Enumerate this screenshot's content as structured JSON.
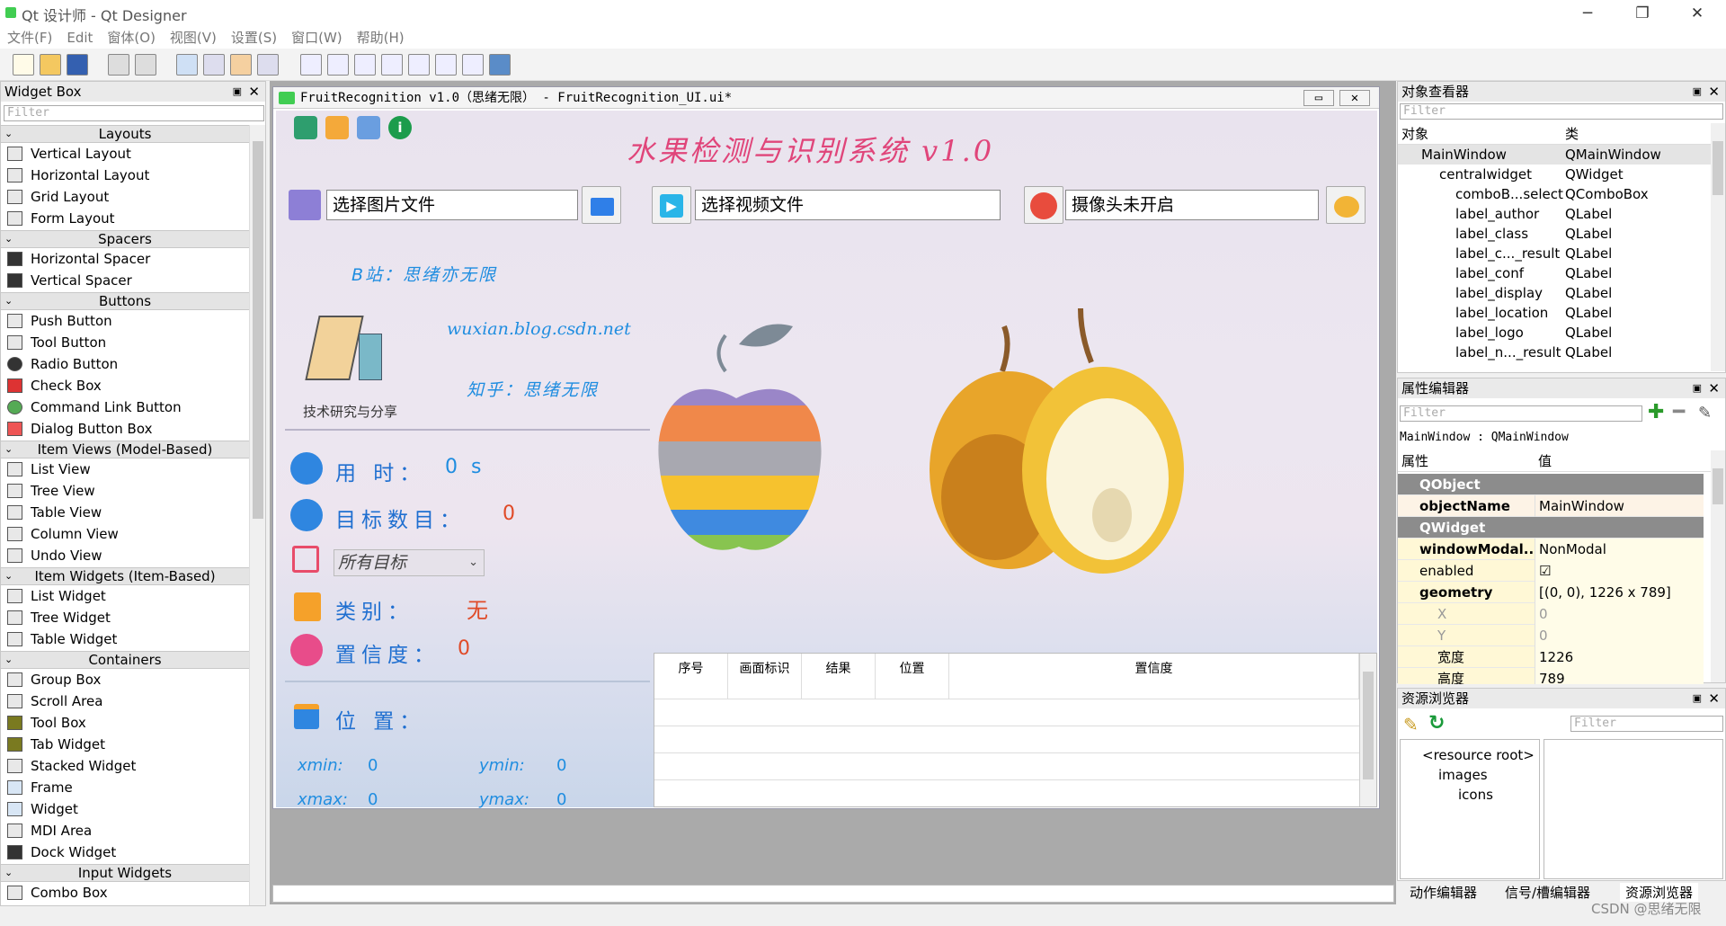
{
  "window": {
    "title": "Qt 设计师 - Qt Designer",
    "min": "─",
    "max": "❐",
    "close": "✕"
  },
  "menu": [
    "文件(F)",
    "Edit",
    "窗体(O)",
    "视图(V)",
    "设置(S)",
    "窗口(W)",
    "帮助(H)"
  ],
  "widget_box": {
    "title": "Widget Box",
    "filter": "Filter",
    "sections": {
      "layouts": "Layouts",
      "spacers": "Spacers",
      "buttons": "Buttons",
      "item_views": "Item Views (Model-Based)",
      "item_widgets": "Item Widgets (Item-Based)",
      "containers": "Containers",
      "input_widgets": "Input Widgets"
    },
    "layouts": [
      "Vertical Layout",
      "Horizontal Layout",
      "Grid Layout",
      "Form Layout"
    ],
    "spacers": [
      "Horizontal Spacer",
      "Vertical Spacer"
    ],
    "buttons": [
      "Push Button",
      "Tool Button",
      "Radio Button",
      "Check Box",
      "Command Link Button",
      "Dialog Button Box"
    ],
    "item_views": [
      "List View",
      "Tree View",
      "Table View",
      "Column View",
      "Undo View"
    ],
    "item_widgets": [
      "List Widget",
      "Tree Widget",
      "Table Widget"
    ],
    "containers": [
      "Group Box",
      "Scroll Area",
      "Tool Box",
      "Tab Widget",
      "Stacked Widget",
      "Frame",
      "Widget",
      "MDI Area",
      "Dock Widget"
    ],
    "input_widgets": [
      "Combo Box"
    ]
  },
  "form": {
    "title": "FruitRecognition v1.0（思绪无限） - FruitRecognition_UI.ui*",
    "app_title": "水果检测与识别系统  v1.0",
    "image_input": "选择图片文件",
    "video_input": "选择视频文件",
    "camera_input": "摄像头未开启",
    "bilibili": "B站：思绪亦无限",
    "blog": "wuxian.blog.csdn.net",
    "zhihu": "知乎：思绪无限",
    "logo_caption": "技术研究与分享",
    "time_label": "用 时：",
    "time_value": "0 s",
    "count_label": "目标数目：",
    "count_value": "0",
    "target_select": "所有目标",
    "class_label": "类别：",
    "class_value": "无",
    "conf_label": "置信度：",
    "conf_value": "0",
    "loc_label": "位 置：",
    "xmin_label": "xmin:",
    "xmin_value": "0",
    "ymin_label": "ymin:",
    "ymin_value": "0",
    "xmax_label": "xmax:",
    "xmax_value": "0",
    "ymax_label": "ymax:",
    "ymax_value": "0",
    "table_headers": [
      "序号",
      "画面标识",
      "结果",
      "位置",
      "置信度"
    ]
  },
  "object_inspector": {
    "title": "对象查看器",
    "filter": "Filter",
    "col_object": "对象",
    "col_class": "类",
    "rows": [
      [
        "MainWindow",
        "QMainWindow"
      ],
      [
        "centralwidget",
        "QWidget"
      ],
      [
        "comboB...select",
        "QComboBox"
      ],
      [
        "label_author",
        "QLabel"
      ],
      [
        "label_class",
        "QLabel"
      ],
      [
        "label_c..._result",
        "QLabel"
      ],
      [
        "label_conf",
        "QLabel"
      ],
      [
        "label_display",
        "QLabel"
      ],
      [
        "label_location",
        "QLabel"
      ],
      [
        "label_logo",
        "QLabel"
      ],
      [
        "label_n..._result",
        "QLabel"
      ]
    ]
  },
  "property_editor": {
    "title": "属性编辑器",
    "filter": "Filter",
    "context": "MainWindow : QMainWindow",
    "col_prop": "属性",
    "col_val": "值",
    "rows": [
      {
        "k": "QObject",
        "v": "",
        "type": "group"
      },
      {
        "k": "objectName",
        "v": "MainWindow",
        "type": "bold"
      },
      {
        "k": "QWidget",
        "v": "",
        "type": "group"
      },
      {
        "k": "windowModal...",
        "v": "NonModal",
        "type": "yellow"
      },
      {
        "k": "enabled",
        "v": "☑",
        "type": "yellow"
      },
      {
        "k": "geometry",
        "v": "[(0, 0), 1226 x 789]",
        "type": "yellowbold"
      },
      {
        "k": "X",
        "v": "0",
        "type": "sub"
      },
      {
        "k": "Y",
        "v": "0",
        "type": "sub"
      },
      {
        "k": "宽度",
        "v": "1226",
        "type": "sub"
      },
      {
        "k": "高度",
        "v": "789",
        "type": "sub"
      }
    ]
  },
  "resource_browser": {
    "title": "资源浏览器",
    "filter": "Filter",
    "tree": [
      "<resource root>",
      "images",
      "icons"
    ]
  },
  "bottom_tabs": [
    "动作编辑器",
    "信号/槽编辑器",
    "资源浏览器"
  ],
  "watermark": "CSDN @思绪无限",
  "colors": {
    "accent_blue": "#1f6fd0",
    "value_orange": "#e04a27",
    "title_pink": "#e0457a"
  }
}
